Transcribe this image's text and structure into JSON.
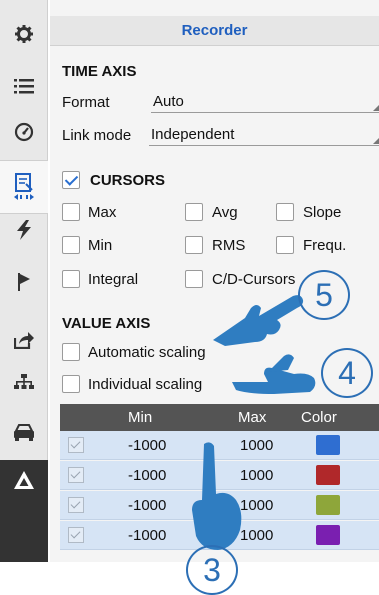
{
  "sidebar": {
    "items": [
      {
        "name": "settings",
        "icon": "gear-icon"
      },
      {
        "name": "list",
        "icon": "list-icon"
      },
      {
        "name": "gauge",
        "icon": "gauge-icon"
      },
      {
        "name": "recorder",
        "icon": "recorder-icon",
        "active": true
      },
      {
        "name": "trigger",
        "icon": "lightning-icon"
      },
      {
        "name": "marker",
        "icon": "flag-icon"
      },
      {
        "name": "export",
        "icon": "share-icon"
      },
      {
        "name": "network",
        "icon": "hierarchy-icon"
      },
      {
        "name": "vehicle",
        "icon": "car-icon"
      },
      {
        "name": "brand",
        "icon": "triangle-logo-icon"
      }
    ]
  },
  "panel": {
    "title": "Recorder",
    "time_axis": {
      "title": "TIME AXIS",
      "format_label": "Format",
      "format_value": "Auto",
      "link_label": "Link mode",
      "link_value": "Independent"
    },
    "cursors": {
      "title": "CURSORS",
      "enabled": true,
      "options": [
        {
          "label": "Max",
          "checked": false
        },
        {
          "label": "Avg",
          "checked": false
        },
        {
          "label": "Slope",
          "checked": false
        },
        {
          "label": "Min",
          "checked": false
        },
        {
          "label": "RMS",
          "checked": false
        },
        {
          "label": "Frequ.",
          "checked": false
        },
        {
          "label": "Integral",
          "checked": false
        },
        {
          "label": "C/D-Cursors",
          "checked": false
        }
      ]
    },
    "value_axis": {
      "title": "VALUE AXIS",
      "automatic_label": "Automatic scaling",
      "automatic_checked": false,
      "individual_label": "Individual scaling",
      "individual_checked": false
    },
    "table": {
      "headers": [
        "Min",
        "Max",
        "Color"
      ],
      "rows": [
        {
          "checked": true,
          "min": "-1000",
          "max": "1000",
          "color": "#2f6ed1"
        },
        {
          "checked": true,
          "min": "-1000",
          "max": "1000",
          "color": "#b0282a"
        },
        {
          "checked": true,
          "min": "-1000",
          "max": "1000",
          "color": "#8ea63a"
        },
        {
          "checked": true,
          "min": "-1000",
          "max": "1000",
          "color": "#7a1fb0"
        }
      ]
    }
  },
  "annotations": {
    "badge_3": "3",
    "badge_4": "4",
    "badge_5": "5"
  },
  "colors": {
    "accent": "#1f5fbf",
    "annotation": "#2c6fb5",
    "table_header": "#545454",
    "table_row": "#d6e4f5"
  }
}
